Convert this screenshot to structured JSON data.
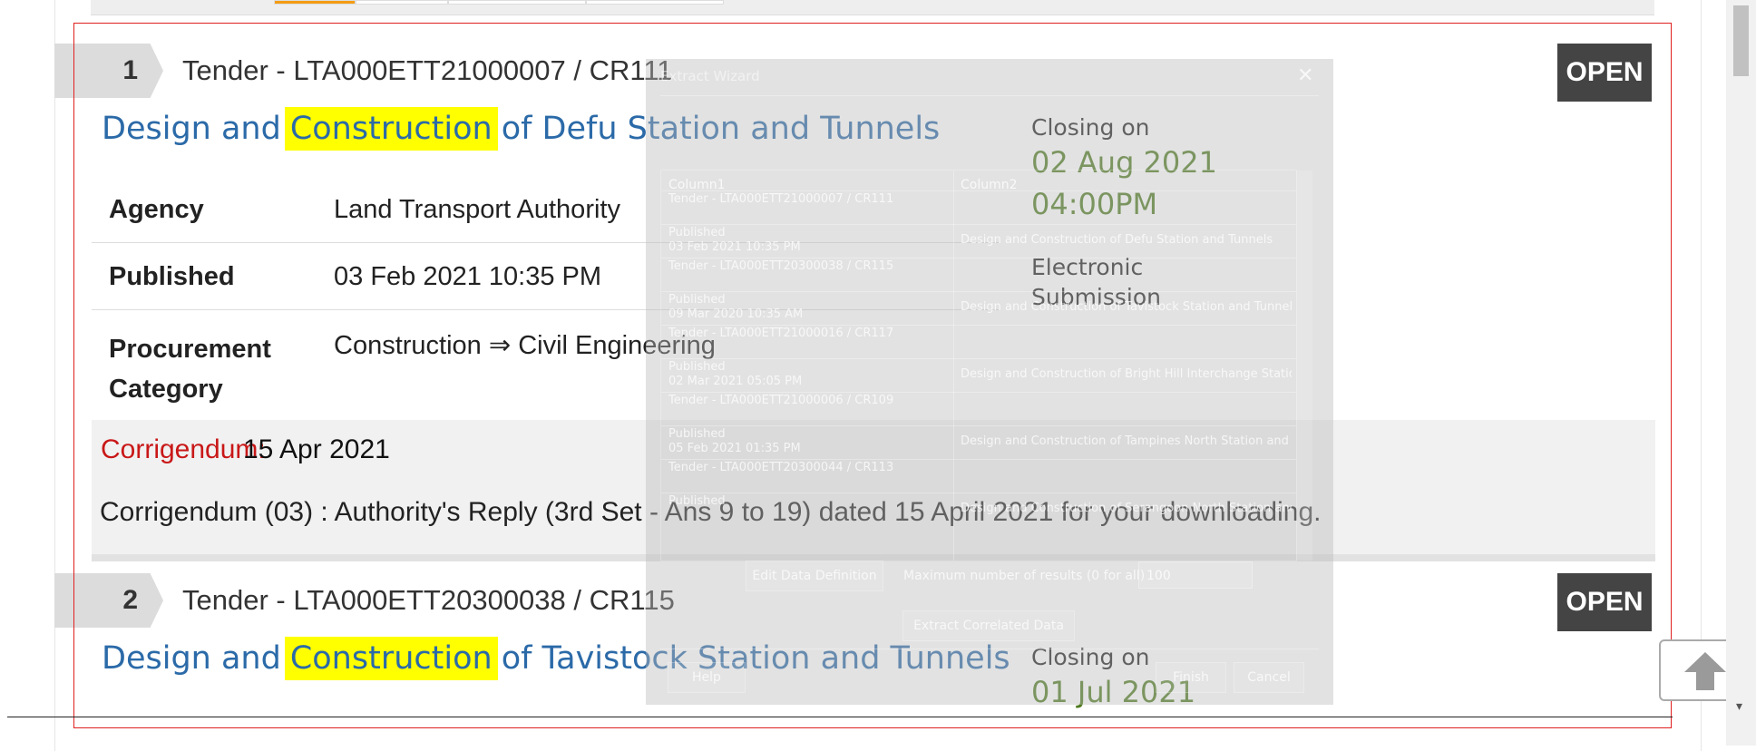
{
  "results": [
    {
      "number": "1",
      "tender_ref": "Tender - LTA000ETT21000007 / CR111",
      "status": "OPEN",
      "title_before": "Design and",
      "title_keyword": "Construction",
      "title_after": "of Defu Station and Tunnels",
      "closing_label": "Closing on",
      "closing_date": "02 Aug 2021",
      "closing_time": "04:00PM",
      "submission": "Electronic Submission",
      "details": [
        {
          "label": "Agency",
          "value": "Land Transport Authority"
        },
        {
          "label": "Published",
          "value": "03 Feb 2021 10:35 PM"
        },
        {
          "label": "Procurement Category",
          "value": "Construction ⇒ Civil Engineering"
        }
      ],
      "corrigendum_label": "Corrigendum:",
      "corrigendum_date": "15 Apr 2021",
      "corrigendum_text": "Corrigendum (03) : Authority's Reply (3rd Set - Ans 9 to 19) dated 15 April 2021 for your downloading."
    },
    {
      "number": "2",
      "tender_ref": "Tender - LTA000ETT20300038 / CR115",
      "status": "OPEN",
      "title_before": "Design and",
      "title_keyword": "Construction",
      "title_after": "of Tavistock Station and Tunnels",
      "closing_label": "Closing on",
      "closing_date": "01 Jul 2021"
    }
  ],
  "wizard": {
    "title": "Extract Wizard",
    "columns": [
      "Column1",
      "Column2"
    ],
    "rows": [
      {
        "c1": "Tender - LTA000ETT21000007 / CR111",
        "c2": ""
      },
      {
        "c1": "Published\n03 Feb 2021 10:35 PM",
        "c2": "Design and Construction of Defu Station and Tunnels"
      },
      {
        "c1": "Tender - LTA000ETT20300038 / CR115",
        "c2": ""
      },
      {
        "c1": "Published\n09 Mar 2020 10:35 AM",
        "c2": "Design and Construction of Tavistock Station and Tunnels"
      },
      {
        "c1": "Tender - LTA000ETT21000016 / CR117",
        "c2": ""
      },
      {
        "c1": "Published\n02 Mar 2021 05:05 PM",
        "c2": "Design and Construction of Bright Hill Interchange Station a"
      },
      {
        "c1": "Tender - LTA000ETT21000006 / CR109",
        "c2": ""
      },
      {
        "c1": "Published\n05 Feb 2021 01:35 PM",
        "c2": "Design and Construction of Tampines North Station and Tur"
      },
      {
        "c1": "Tender - LTA000ETT20300044 / CR113",
        "c2": ""
      },
      {
        "c1": "Published",
        "c2": "Design and Construction of Serangoon North Station and T"
      }
    ],
    "edit_button": "Edit Data Definition",
    "max_results_label": "Maximum number of results (0 for all)",
    "max_results_value": "100",
    "extract_button": "Extract Correlated Data",
    "help_button": "Help",
    "finish_button": "Finish",
    "cancel_button": "Cancel"
  },
  "colors": {
    "title_blue": "#2b6aa8",
    "keyword_highlight": "#ffff00",
    "closing_green": "#4e7a1f",
    "corrigendum_red": "#c91818",
    "badge_dark": "#444444"
  },
  "icons": {
    "back_to_top": "arrow-up-icon",
    "wizard_close": "close-icon"
  }
}
